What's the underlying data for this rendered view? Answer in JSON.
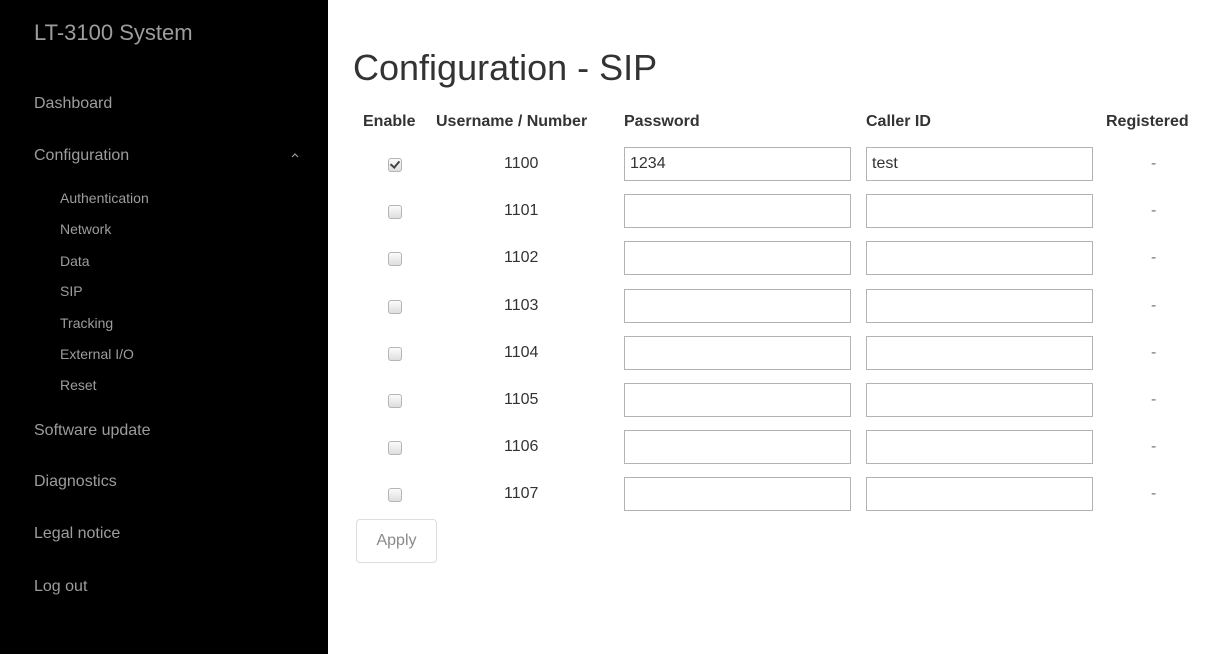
{
  "sidebar": {
    "brand": "LT-3100 System",
    "items": {
      "dashboard": "Dashboard",
      "configuration": "Configuration",
      "software_update": "Software update",
      "diagnostics": "Diagnostics",
      "legal_notice": "Legal notice",
      "log_out": "Log out"
    },
    "sub_items": {
      "authentication": "Authentication",
      "network": "Network",
      "data": "Data",
      "sip": "SIP",
      "tracking": "Tracking",
      "external_io": "External I/O",
      "reset": "Reset"
    }
  },
  "page": {
    "title": "Configuration - SIP"
  },
  "table": {
    "headers": {
      "enable": "Enable",
      "username": "Username / Number",
      "password": "Password",
      "caller_id": "Caller ID",
      "registered": "Registered"
    },
    "rows": [
      {
        "enabled": true,
        "number": "1100",
        "password": "1234",
        "caller_id": "test",
        "registered": "-"
      },
      {
        "enabled": false,
        "number": "1101",
        "password": "",
        "caller_id": "",
        "registered": "-"
      },
      {
        "enabled": false,
        "number": "1102",
        "password": "",
        "caller_id": "",
        "registered": "-"
      },
      {
        "enabled": false,
        "number": "1103",
        "password": "",
        "caller_id": "",
        "registered": "-"
      },
      {
        "enabled": false,
        "number": "1104",
        "password": "",
        "caller_id": "",
        "registered": "-"
      },
      {
        "enabled": false,
        "number": "1105",
        "password": "",
        "caller_id": "",
        "registered": "-"
      },
      {
        "enabled": false,
        "number": "1106",
        "password": "",
        "caller_id": "",
        "registered": "-"
      },
      {
        "enabled": false,
        "number": "1107",
        "password": "",
        "caller_id": "",
        "registered": "-"
      }
    ]
  },
  "actions": {
    "apply_label": "Apply"
  },
  "icons": {
    "configuration_caret": "chevron-up-icon"
  },
  "colors": {
    "sidebar_bg": "#000000",
    "sidebar_text": "#9d9d9d"
  }
}
